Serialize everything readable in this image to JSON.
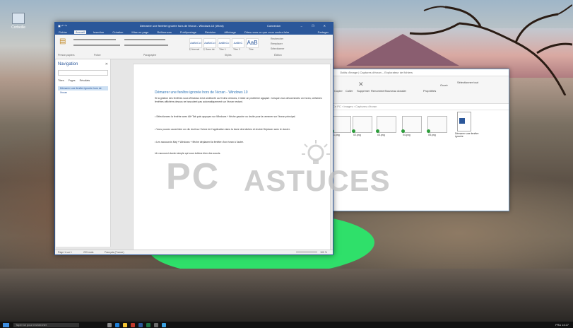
{
  "desktop": {
    "icon_label": "Corbeille"
  },
  "word": {
    "title": "Démarrer une fenêtre ignorée hors de l'écran - Windows 10 (Word)",
    "user": "Connexion",
    "window_controls": "– ❐ ✕",
    "tabs": [
      "Fichier",
      "Accueil",
      "Insertion",
      "Création",
      "Mise en page",
      "Références",
      "Publipostage",
      "Révision",
      "Affichage",
      "Dites-nous ce que vous voulez faire"
    ],
    "share": "Partager",
    "styles": [
      "AaBbCcI",
      "AaBbCcI",
      "AaBbCc",
      "AaBbC",
      "AaB"
    ],
    "style_names": [
      "¶ Normal",
      "¶ Sans int.",
      "Titre 1",
      "Titre 2",
      "Titre"
    ],
    "ribbon_right": [
      "Rechercher",
      "Remplacer",
      "Sélectionner"
    ],
    "ribbon_groups": [
      "Presse-papiers",
      "Police",
      "Paragraphe",
      "Styles",
      "Édition"
    ],
    "nav": {
      "title": "Navigation",
      "tabs": [
        "Titres",
        "Pages",
        "Résultats"
      ],
      "heading": "Démarrer une fenêtre ignorée hors de l'écran"
    },
    "doc": {
      "title": "Démarrer une fenêtre ignorée hors de l'écran - Windows 10",
      "paragraphs": [
        "Si la gestion des fenêtres sous Windows s'est améliorée au fil des versions, il reste un problème agaçant : lorsque vous déconnectez un écran, certaines fenêtres affichées dessus ne basculent pas automatiquement sur l'écran restant.",
        "• Sélectionnez la fenêtre avec Alt+Tab puis appuyez sur Windows + flèche gauche ou droite pour la ramener sur l'écran principal.",
        "• Vous pouvez aussi faire un clic droit sur l'icône de l'application dans la barre des tâches et choisir Déplacer avec le clavier.",
        "• Les raccourcis Maj + Windows + flèche déplacent la fenêtre d'un écran à l'autre.",
        "Un raccourci clavier simple qui vous évitera bien des soucis."
      ]
    },
    "status": {
      "page": "Page 1 sur 1",
      "words": "233 mots",
      "language": "Français (France)",
      "zoom": "100 %"
    }
  },
  "explorer": {
    "title": "Outils d'image  |  Captures d'écran  –  Explorateur de fichiers",
    "address": "Ce PC › Images › Captures d'écran",
    "ribbon": [
      "Copier",
      "Coller",
      "Supprimer",
      "Renommer",
      "Nouveau dossier",
      "Propriétés",
      "Ouvrir",
      "Sélectionner tout"
    ],
    "thumbs": [
      "01.png",
      "02.png",
      "03.png",
      "04.png",
      "05.png",
      "06.png"
    ],
    "word_file": "Démarrer une fenêtre ignorée"
  },
  "watermark": {
    "pc": "PC",
    "astuces": "ASTUCES"
  },
  "taskbar": {
    "search": "Taper ici pour rechercher",
    "tray": "FRA 14:27"
  },
  "colors": {
    "word_blue": "#2b579a",
    "lake_green": "#2fe06a"
  }
}
